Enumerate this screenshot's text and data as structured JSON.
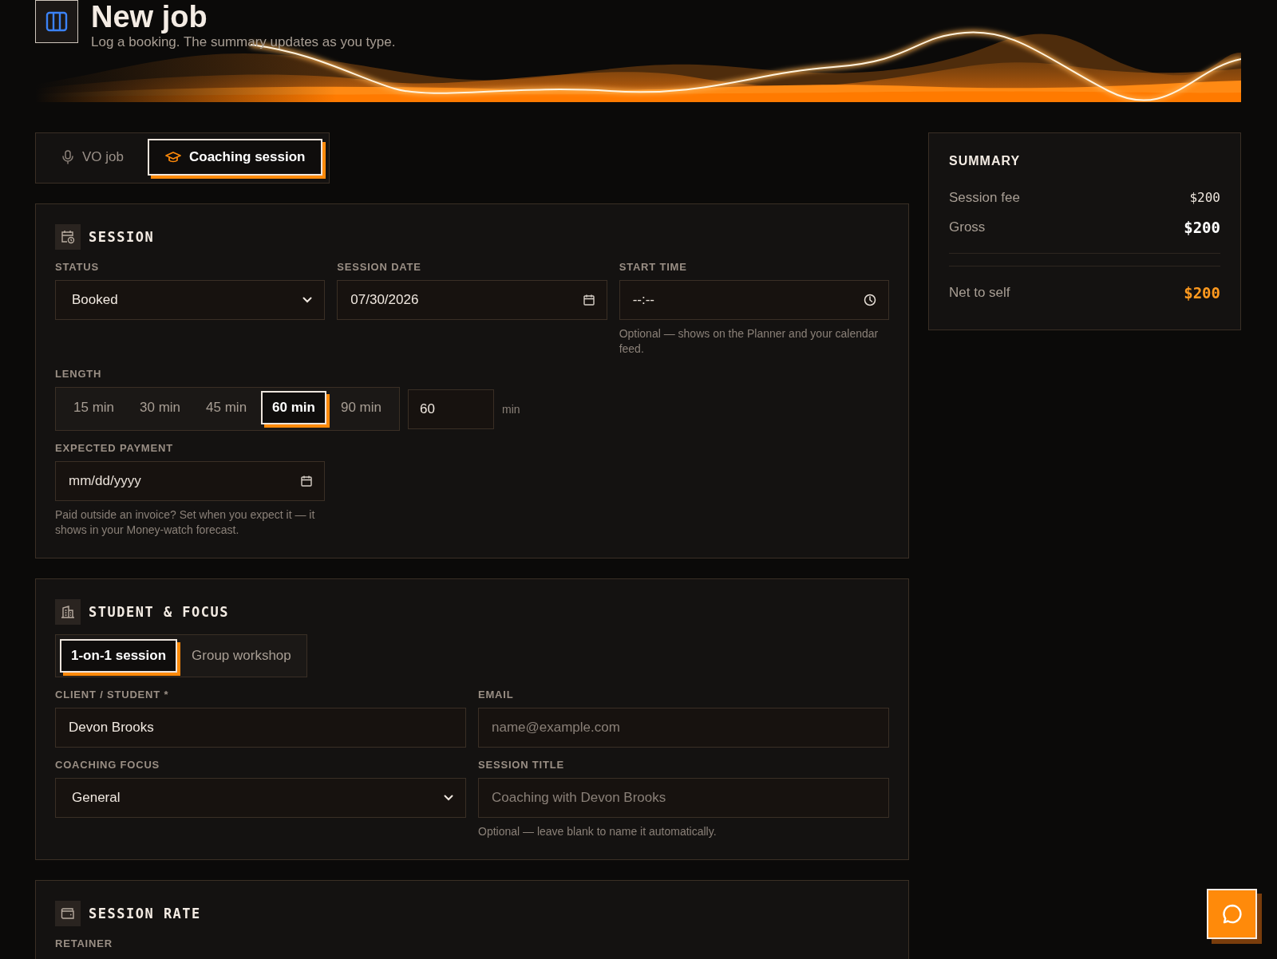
{
  "header": {
    "title": "New job",
    "subtitle": "Log a booking. The summary updates as you type."
  },
  "job_types": [
    {
      "label": "VO job",
      "selected": false
    },
    {
      "label": "Coaching session",
      "selected": true
    }
  ],
  "session": {
    "title": "SESSION",
    "status": {
      "label": "STATUS",
      "value": "Booked"
    },
    "session_date": {
      "label": "SESSION DATE",
      "value": "07/30/2026"
    },
    "start_time": {
      "label": "START TIME",
      "placeholder": "--:--",
      "hint": "Optional — shows on the Planner and your calendar feed."
    },
    "length": {
      "label": "LENGTH",
      "options": [
        {
          "label": "15 min",
          "selected": false
        },
        {
          "label": "30 min",
          "selected": false
        },
        {
          "label": "45 min",
          "selected": false
        },
        {
          "label": "60 min",
          "selected": true
        },
        {
          "label": "90 min",
          "selected": false
        }
      ],
      "custom_value": "60",
      "unit": "min"
    },
    "expected_payment": {
      "label": "EXPECTED PAYMENT",
      "placeholder": "mm/dd/yyyy",
      "hint": "Paid outside an invoice? Set when you expect it — it shows in your Money-watch forecast."
    }
  },
  "student": {
    "title": "STUDENT & FOCUS",
    "session_types": [
      {
        "label": "1-on-1 session",
        "selected": true
      },
      {
        "label": "Group workshop",
        "selected": false
      }
    ],
    "client": {
      "label": "CLIENT / STUDENT *",
      "value": "Devon Brooks"
    },
    "email": {
      "label": "EMAIL",
      "placeholder": "name@example.com"
    },
    "focus": {
      "label": "COACHING FOCUS",
      "value": "General"
    },
    "session_title": {
      "label": "SESSION TITLE",
      "placeholder": "Coaching with Devon Brooks",
      "hint": "Optional — leave blank to name it automatically."
    }
  },
  "rate": {
    "title": "SESSION RATE",
    "field_label": "RETAINER"
  },
  "summary": {
    "title": "SUMMARY",
    "rows": [
      {
        "label": "Session fee",
        "value": "$200",
        "kind": "line"
      },
      {
        "label": "Gross",
        "value": "$200",
        "kind": "total"
      },
      {
        "label": "Net to self",
        "value": "$200",
        "kind": "net"
      }
    ]
  }
}
